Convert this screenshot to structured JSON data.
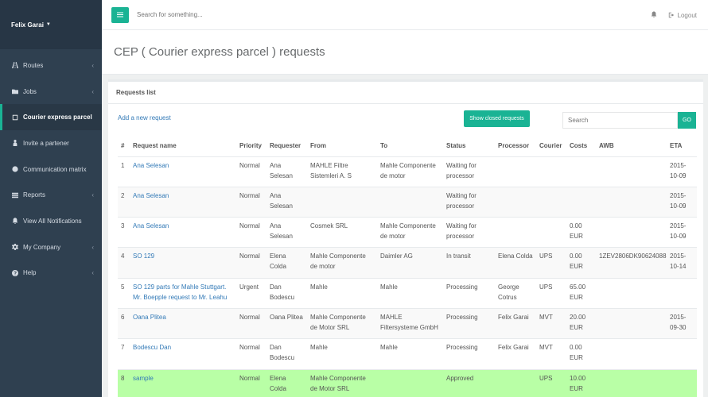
{
  "user": {
    "name": "Felix Garai"
  },
  "nav": [
    {
      "label": "Routes",
      "icon": "road-icon",
      "chevron": true
    },
    {
      "label": "Jobs",
      "icon": "folder-icon",
      "chevron": true
    },
    {
      "label": "Courier express parcel",
      "icon": "square-icon",
      "chevron": false,
      "active": true
    },
    {
      "label": "Invite a partener",
      "icon": "person-icon",
      "chevron": false
    },
    {
      "label": "Communication matrix",
      "icon": "globe-icon",
      "chevron": false
    },
    {
      "label": "Reports",
      "icon": "list-icon",
      "chevron": true
    },
    {
      "label": "View All Notifications",
      "icon": "bell-icon",
      "chevron": false
    },
    {
      "label": "My Company",
      "icon": "gear-icon",
      "chevron": true
    },
    {
      "label": "Help",
      "icon": "question-icon",
      "chevron": true
    }
  ],
  "topbar": {
    "search_placeholder": "Search for something...",
    "logout": "Logout"
  },
  "page": {
    "title": "CEP ( Courier express parcel ) requests"
  },
  "panel": {
    "title": "Requests list",
    "add_link": "Add a new request",
    "show_closed": "Show closed requests",
    "search_placeholder": "Search",
    "go": "GO"
  },
  "table": {
    "headers": [
      "#",
      "Request name",
      "Priority",
      "Requester",
      "From",
      "To",
      "Status",
      "Processor",
      "Courier",
      "Costs",
      "AWB",
      "ETA"
    ],
    "rows": [
      [
        "1",
        "Ana Selesan",
        "Normal",
        "Ana Selesan",
        "MAHLE Filtre Sistemleri A. S",
        "Mahle Componente de motor",
        "Waiting for processor",
        "",
        "",
        "",
        "",
        "2015-10-09"
      ],
      [
        "2",
        "Ana Selesan",
        "Normal",
        "Ana Selesan",
        "",
        "",
        "Waiting for processor",
        "",
        "",
        "",
        "",
        "2015-10-09"
      ],
      [
        "3",
        "Ana Selesan",
        "Normal",
        "Ana Selesan",
        "Cosmek SRL",
        "Mahle Componente de motor",
        "Waiting for processor",
        "",
        "",
        "0.00 EUR",
        "",
        "2015-10-09"
      ],
      [
        "4",
        "SO 129",
        "Normal",
        "Elena Colda",
        "Mahle Componente de motor",
        "Daimler AG",
        "In transit",
        "Elena Colda",
        "UPS",
        "0.00 EUR",
        "1ZEV2806DK90624088",
        "2015-10-14"
      ],
      [
        "5",
        "SO 129 parts for Mahle Stuttgart. Mr. Boepple request to Mr. Leahu",
        "Urgent",
        "Dan Bodescu",
        "Mahle",
        "Mahle",
        "Processing",
        "George Cotrus",
        "UPS",
        "65.00 EUR",
        "",
        ""
      ],
      [
        "6",
        "Oana Plitea",
        "Normal",
        "Oana Plitea",
        "Mahle Componente de Motor SRL",
        "MAHLE Filtersysteme GmbH",
        "Processing",
        "Felix Garai",
        "MVT",
        "20.00 EUR",
        "",
        "2015-09-30"
      ],
      [
        "7",
        "Bodescu Dan",
        "Normal",
        "Dan Bodescu",
        "Mahle",
        "Mahle",
        "Processing",
        "Felix Garai",
        "MVT",
        "0.00 EUR",
        "",
        ""
      ],
      [
        "8",
        "sample",
        "Normal",
        "Elena Colda",
        "Mahle Componente de Motor SRL",
        "",
        "Approved",
        "",
        "UPS",
        "10.00 EUR",
        "",
        ""
      ]
    ]
  },
  "colors": {
    "accent": "#1ab394",
    "sidebar": "#2f4050",
    "approved_row": "#b9ffa6",
    "link": "#337ab7"
  }
}
